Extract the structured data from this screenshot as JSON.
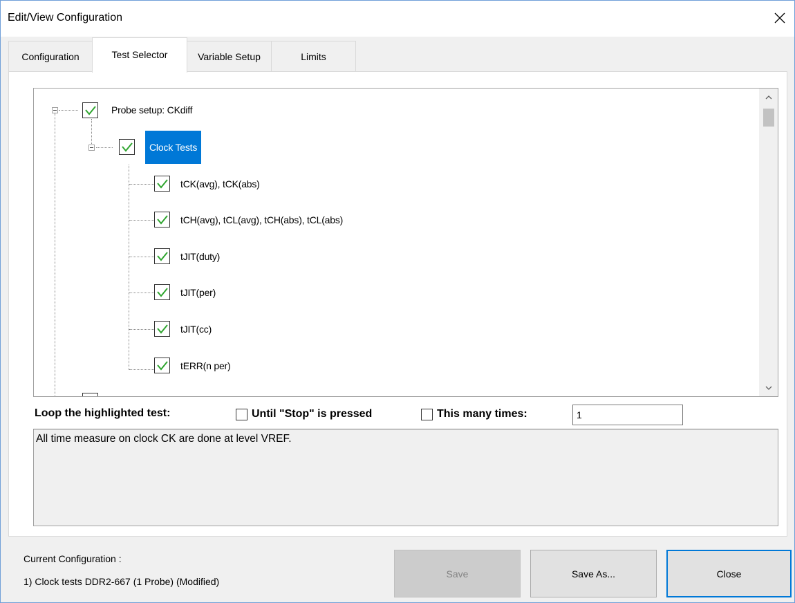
{
  "window": {
    "title": "Edit/View Configuration"
  },
  "tabs": [
    {
      "label": "Configuration",
      "active": false
    },
    {
      "label": "Test Selector",
      "active": true
    },
    {
      "label": "Variable Setup",
      "active": false
    },
    {
      "label": "Limits",
      "active": false
    }
  ],
  "tree": {
    "root": {
      "label": "Probe setup: CKdiff",
      "checked": true
    },
    "group": {
      "label": "Clock Tests",
      "checked": true,
      "selected": true
    },
    "tests": [
      {
        "label": "tCK(avg), tCK(abs)",
        "checked": true
      },
      {
        "label": "tCH(avg), tCL(avg), tCH(abs), tCL(abs)",
        "checked": true
      },
      {
        "label": "tJIT(duty)",
        "checked": true
      },
      {
        "label": "tJIT(per)",
        "checked": true
      },
      {
        "label": "tJIT(cc)",
        "checked": true
      },
      {
        "label": "tERR(n per)",
        "checked": true
      }
    ]
  },
  "loop": {
    "label": "Loop the highlighted test:",
    "until_stop_label": "Until \"Stop\" is pressed",
    "until_stop_checked": false,
    "many_times_label": "This many times:",
    "many_times_checked": false,
    "count_value": "1"
  },
  "description": "All time measure on clock CK are done at level VREF.",
  "footer": {
    "current_config_title": "Current Configuration :",
    "current_config_value": "1) Clock tests DDR2-667 (1 Probe)  (Modified)",
    "save_label": "Save",
    "save_as_label": "Save As...",
    "close_label": "Close"
  },
  "colors": {
    "selection": "#0078d7",
    "check": "#2fa52f",
    "window_border": "#6f9fd8"
  }
}
